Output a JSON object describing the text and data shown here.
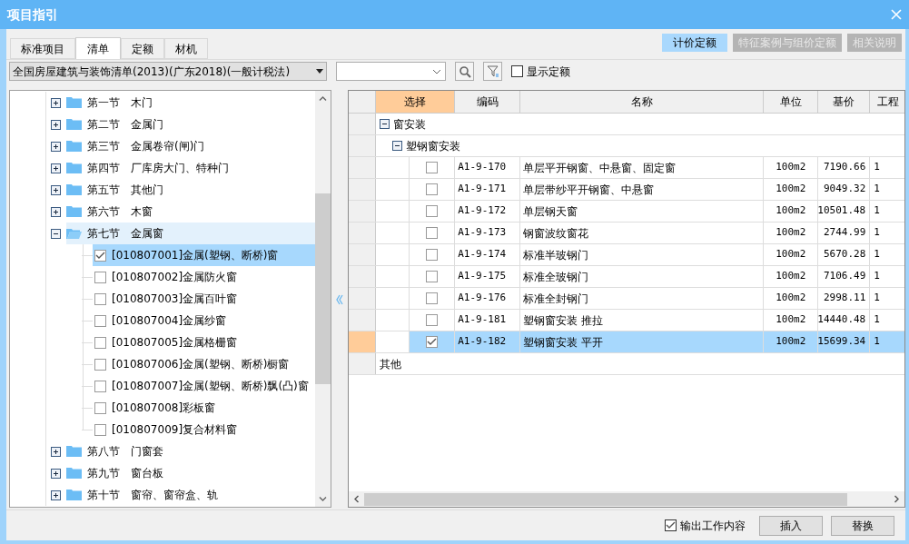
{
  "window": {
    "title": "项目指引"
  },
  "tabs": [
    {
      "label": "标准项目",
      "selected": false
    },
    {
      "label": "清单",
      "selected": true
    },
    {
      "label": "定额",
      "selected": false
    },
    {
      "label": "材机",
      "selected": false
    }
  ],
  "right_buttons": [
    {
      "label": "计价定额",
      "selected": true
    },
    {
      "label": "特征案例与组价定额",
      "selected": false
    },
    {
      "label": "相关说明",
      "selected": false
    }
  ],
  "library_dropdown": {
    "value": "全国房屋建筑与装饰清单(2013)(广东2018)(一般计税法)"
  },
  "show_quota": {
    "label": "显示定额",
    "checked": false
  },
  "tree": [
    {
      "number": "第一节",
      "name": "木门",
      "expanded": false,
      "selected": false
    },
    {
      "number": "第二节",
      "name": "金属门",
      "expanded": false,
      "selected": false
    },
    {
      "number": "第三节",
      "name": "金属卷帘(闸)门",
      "expanded": false,
      "selected": false
    },
    {
      "number": "第四节",
      "name": "厂库房大门、特种门",
      "expanded": false,
      "selected": false
    },
    {
      "number": "第五节",
      "name": "其他门",
      "expanded": false,
      "selected": false
    },
    {
      "number": "第六节",
      "name": "木窗",
      "expanded": false,
      "selected": false
    },
    {
      "number": "第七节",
      "name": "金属窗",
      "expanded": true,
      "selected": true,
      "children": [
        {
          "label": "[010807001]金属(塑钢、断桥)窗",
          "checked": true,
          "selected": true
        },
        {
          "label": "[010807002]金属防火窗",
          "checked": false,
          "selected": false
        },
        {
          "label": "[010807003]金属百叶窗",
          "checked": false,
          "selected": false
        },
        {
          "label": "[010807004]金属纱窗",
          "checked": false,
          "selected": false
        },
        {
          "label": "[010807005]金属格栅窗",
          "checked": false,
          "selected": false
        },
        {
          "label": "[010807006]金属(塑钢、断桥)橱窗",
          "checked": false,
          "selected": false
        },
        {
          "label": "[010807007]金属(塑钢、断桥)飘(凸)窗",
          "checked": false,
          "selected": false
        },
        {
          "label": "[010807008]彩板窗",
          "checked": false,
          "selected": false
        },
        {
          "label": "[010807009]复合材料窗",
          "checked": false,
          "selected": false
        }
      ]
    },
    {
      "number": "第八节",
      "name": "门窗套",
      "expanded": false,
      "selected": false
    },
    {
      "number": "第九节",
      "name": "窗台板",
      "expanded": false,
      "selected": false
    },
    {
      "number": "第十节",
      "name": "窗帘、窗帘盒、轨",
      "expanded": false,
      "selected": false
    }
  ],
  "grid": {
    "columns": [
      "选择",
      "编码",
      "名称",
      "单位",
      "基价",
      "工程"
    ],
    "groups": [
      {
        "label": "窗安装",
        "expanded": true,
        "children": [
          {
            "label": "塑钢窗安装",
            "expanded": true,
            "rows": [
              {
                "checked": false,
                "selected": false,
                "code": "A1-9-170",
                "name": "单层平开钢窗、中悬窗、固定窗",
                "unit": "100m2",
                "price": "7190.66",
                "column_6": "1"
              },
              {
                "checked": false,
                "selected": false,
                "code": "A1-9-171",
                "name": "单层带纱平开钢窗、中悬窗",
                "unit": "100m2",
                "price": "9049.32",
                "column_6": "1"
              },
              {
                "checked": false,
                "selected": false,
                "code": "A1-9-172",
                "name": "单层钢天窗",
                "unit": "100m2",
                "price": "10501.48",
                "column_6": "1"
              },
              {
                "checked": false,
                "selected": false,
                "code": "A1-9-173",
                "name": "钢窗波纹窗花",
                "unit": "100m2",
                "price": "2744.99",
                "column_6": "1"
              },
              {
                "checked": false,
                "selected": false,
                "code": "A1-9-174",
                "name": "标准半玻钢门",
                "unit": "100m2",
                "price": "5670.28",
                "column_6": "1"
              },
              {
                "checked": false,
                "selected": false,
                "code": "A1-9-175",
                "name": "标准全玻钢门",
                "unit": "100m2",
                "price": "7106.49",
                "column_6": "1"
              },
              {
                "checked": false,
                "selected": false,
                "code": "A1-9-176",
                "name": "标准全封钢门",
                "unit": "100m2",
                "price": "2998.11",
                "column_6": "1"
              },
              {
                "checked": false,
                "selected": false,
                "code": "A1-9-181",
                "name": "塑钢窗安装 推拉",
                "unit": "100m2",
                "price": "14440.48",
                "column_6": "1"
              },
              {
                "checked": true,
                "selected": true,
                "code": "A1-9-182",
                "name": "塑钢窗安装 平开",
                "unit": "100m2",
                "price": "15699.34",
                "column_6": "1"
              }
            ]
          }
        ]
      },
      {
        "label": "其他"
      }
    ]
  },
  "output_work": {
    "label": "输出工作内容",
    "checked": true
  },
  "buttons": [
    "插入",
    "替换"
  ]
}
